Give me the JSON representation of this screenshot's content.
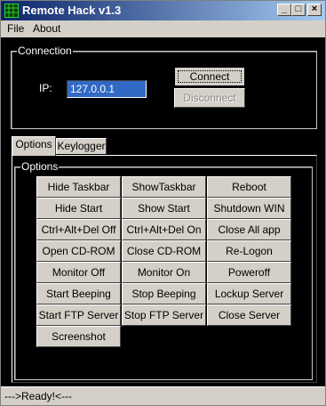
{
  "window": {
    "title": "Remote Hack v1.3",
    "minimize": "_",
    "maximize": "□",
    "close": "×"
  },
  "menu": {
    "file": "File",
    "about": "About"
  },
  "connection": {
    "group_label": "Connection",
    "ip_label": "IP:",
    "ip_value": "127.0.0.1",
    "connect": "Connect",
    "disconnect": "Disconnect"
  },
  "tabs": {
    "options": "Options",
    "keylogger": "Keylogger"
  },
  "options": {
    "group_label": "Options",
    "buttons": [
      [
        "Hide Taskbar",
        "ShowTaskbar",
        "Reboot"
      ],
      [
        "Hide Start",
        "Show Start",
        "Shutdown WIN"
      ],
      [
        "Ctrl+Alt+Del Off",
        "Ctrl+Alt+Del On",
        "Close All app"
      ],
      [
        "Open CD-ROM",
        "Close CD-ROM",
        "Re-Logon"
      ],
      [
        "Monitor Off",
        "Monitor On",
        "Poweroff"
      ],
      [
        "Start Beeping",
        "Stop Beeping",
        "Lockup Server"
      ],
      [
        "Start FTP Server",
        "Stop FTP Server",
        "Close Server"
      ],
      [
        "Screenshot"
      ]
    ]
  },
  "status": {
    "text": "--->Ready!<---"
  }
}
